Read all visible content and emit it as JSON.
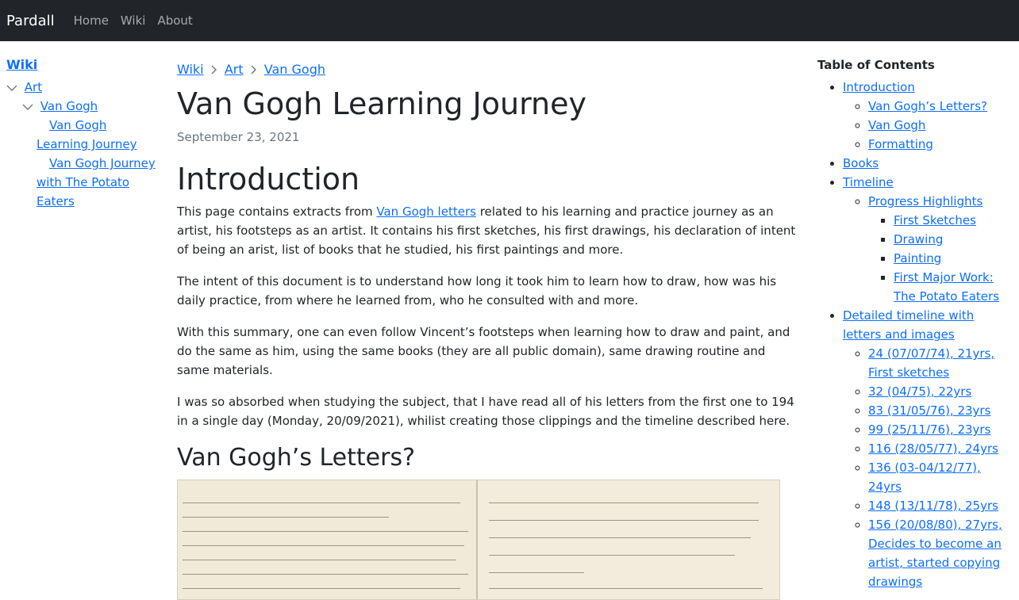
{
  "navbar": {
    "brand": "Pardall",
    "links": [
      "Home",
      "Wiki",
      "About"
    ]
  },
  "sidebar": {
    "root": "Wiki",
    "art": "Art",
    "van_gogh": "Van Gogh",
    "children": [
      "Van Gogh Learning Journey",
      "Van Gogh Journey with The Potato Eaters"
    ]
  },
  "breadcrumb": [
    "Wiki",
    "Art",
    "Van Gogh"
  ],
  "page": {
    "title": "Van Gogh Learning Journey",
    "date": "September 23, 2021",
    "intro_heading": "Introduction",
    "p1_before": "This page contains extracts from ",
    "p1_link": "Van Gogh letters",
    "p1_after": " related to his learning and practice journey as an artist, his footsteps as an artist. It contains his first sketches, his first drawings, his declaration of intent of being an arist, list of books that he studied, his first paintings and more.",
    "p2": "The intent of this document is to understand how long it took him to learn how to draw, how was his daily practice, from where he learned from, who he consulted with and more.",
    "p3": "With this summary, one can even follow Vincent’s footsteps when learning how to draw and paint, and do the same as him, using the same books (they are all public domain), same drawing routine and same materials.",
    "p4": "I was so absorbed when studying the subject, that I have read all of his letters from the first one to 194 in a single day (Monday, 20/09/2021), whilist creating those clippings and the timeline described here.",
    "letters_heading": "Van Gogh’s Letters?"
  },
  "toc": {
    "title": "Table of Contents",
    "introduction": "Introduction",
    "intro_children": [
      "Van Gogh’s Letters?",
      "Van Gogh",
      "Formatting"
    ],
    "books": "Books",
    "timeline": "Timeline",
    "progress": "Progress Highlights",
    "progress_children": [
      "First Sketches",
      "Drawing",
      "Painting",
      "First Major Work: The Potato Eaters"
    ],
    "detailed": "Detailed timeline with letters and images",
    "detailed_children": [
      "24 (07/07/74), 21yrs, First sketches",
      "32 (04/75), 22yrs",
      "83 (31/05/76), 23yrs",
      "99 (25/11/76), 23yrs",
      "116 (28/05/77), 24yrs",
      "136 (03-04/12/77), 24yrs",
      "148 (13/11/78), 25yrs",
      "156 (20/08/80), 27yrs, Decides to become an artist, started copying drawings"
    ]
  }
}
